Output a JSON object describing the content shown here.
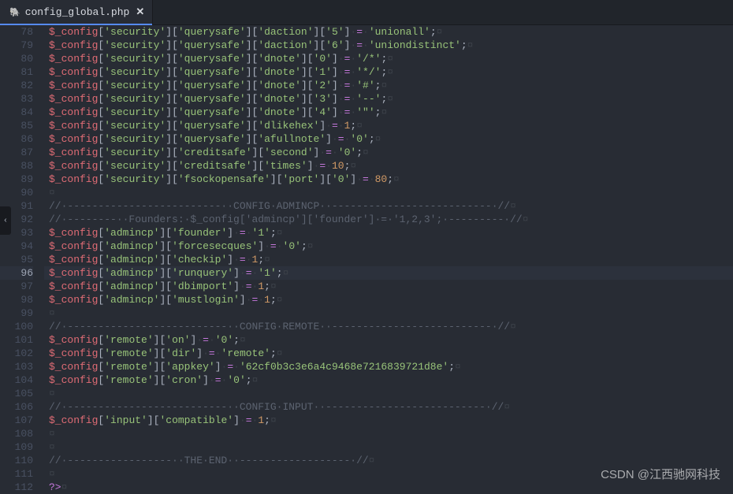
{
  "tab": {
    "filename": "config_global.php",
    "modified_glyph": "✕",
    "file_icon_glyph": "🐘"
  },
  "current_line": 96,
  "lines": [
    {
      "n": 78,
      "type": "assign",
      "var": "$_config",
      "keys": [
        "security",
        "querysafe",
        "daction",
        "5"
      ],
      "value": "unionall",
      "value_kind": "string",
      "suffix": ";"
    },
    {
      "n": 79,
      "type": "assign",
      "var": "$_config",
      "keys": [
        "security",
        "querysafe",
        "daction",
        "6"
      ],
      "value": "uniondistinct",
      "value_kind": "string",
      "suffix": ";"
    },
    {
      "n": 80,
      "type": "assign",
      "var": "$_config",
      "keys": [
        "security",
        "querysafe",
        "dnote",
        "0"
      ],
      "value": "/*",
      "value_kind": "string",
      "suffix": ";"
    },
    {
      "n": 81,
      "type": "assign",
      "var": "$_config",
      "keys": [
        "security",
        "querysafe",
        "dnote",
        "1"
      ],
      "value": "*/",
      "value_kind": "string",
      "suffix": ";"
    },
    {
      "n": 82,
      "type": "assign",
      "var": "$_config",
      "keys": [
        "security",
        "querysafe",
        "dnote",
        "2"
      ],
      "value": "#",
      "value_kind": "string",
      "suffix": ";"
    },
    {
      "n": 83,
      "type": "assign",
      "var": "$_config",
      "keys": [
        "security",
        "querysafe",
        "dnote",
        "3"
      ],
      "value": "--",
      "value_kind": "string",
      "suffix": ";"
    },
    {
      "n": 84,
      "type": "assign",
      "var": "$_config",
      "keys": [
        "security",
        "querysafe",
        "dnote",
        "4"
      ],
      "value": "\"",
      "value_kind": "string",
      "suffix": ";"
    },
    {
      "n": 85,
      "type": "assign",
      "var": "$_config",
      "keys": [
        "security",
        "querysafe",
        "dlikehex"
      ],
      "value": "1",
      "value_kind": "number",
      "suffix": ";"
    },
    {
      "n": 86,
      "type": "assign",
      "var": "$_config",
      "keys": [
        "security",
        "querysafe",
        "afullnote"
      ],
      "value": "0",
      "value_kind": "string",
      "suffix": ";"
    },
    {
      "n": 87,
      "type": "assign",
      "var": "$_config",
      "keys": [
        "security",
        "creditsafe",
        "second"
      ],
      "value": "0",
      "value_kind": "string",
      "suffix": ";"
    },
    {
      "n": 88,
      "type": "assign",
      "var": "$_config",
      "keys": [
        "security",
        "creditsafe",
        "times"
      ],
      "value": "10",
      "value_kind": "number",
      "suffix": ";"
    },
    {
      "n": 89,
      "type": "assign",
      "var": "$_config",
      "keys": [
        "security",
        "fsockopensafe",
        "port",
        "0"
      ],
      "value": "80",
      "value_kind": "number",
      "suffix": ";"
    },
    {
      "n": 90,
      "type": "blank"
    },
    {
      "n": 91,
      "type": "comment",
      "text": "// -------------------------  CONFIG ADMINCP  -------------------------- //"
    },
    {
      "n": 92,
      "type": "comment",
      "text": "// --------  Founders: $_config['admincp']['founder'] = '1,2,3'; --------- //"
    },
    {
      "n": 93,
      "type": "assign",
      "var": "$_config",
      "keys": [
        "admincp",
        "founder"
      ],
      "value": "1",
      "value_kind": "string",
      "suffix": ";"
    },
    {
      "n": 94,
      "type": "assign",
      "var": "$_config",
      "keys": [
        "admincp",
        "forcesecques"
      ],
      "value": "0",
      "value_kind": "string",
      "suffix": ";"
    },
    {
      "n": 95,
      "type": "assign",
      "var": "$_config",
      "keys": [
        "admincp",
        "checkip"
      ],
      "value": "1",
      "value_kind": "number",
      "suffix": ";"
    },
    {
      "n": 96,
      "type": "assign",
      "var": "$_config",
      "keys": [
        "admincp",
        "runquery"
      ],
      "value": "1",
      "value_kind": "string",
      "suffix": ";"
    },
    {
      "n": 97,
      "type": "assign",
      "var": "$_config",
      "keys": [
        "admincp",
        "dbimport"
      ],
      "value": "1",
      "value_kind": "number",
      "suffix": ";"
    },
    {
      "n": 98,
      "type": "assign",
      "var": "$_config",
      "keys": [
        "admincp",
        "mustlogin"
      ],
      "value": "1",
      "value_kind": "number",
      "suffix": ";"
    },
    {
      "n": 99,
      "type": "blank"
    },
    {
      "n": 100,
      "type": "comment",
      "text": "// --------------------------  CONFIG REMOTE  -------------------------- //"
    },
    {
      "n": 101,
      "type": "assign",
      "var": "$_config",
      "keys": [
        "remote",
        "on"
      ],
      "value": "0",
      "value_kind": "string",
      "suffix": ";"
    },
    {
      "n": 102,
      "type": "assign",
      "var": "$_config",
      "keys": [
        "remote",
        "dir"
      ],
      "value": "remote",
      "value_kind": "string",
      "suffix": ";"
    },
    {
      "n": 103,
      "type": "assign",
      "var": "$_config",
      "keys": [
        "remote",
        "appkey"
      ],
      "value": "62cf0b3c3e6a4c9468e7216839721d8e",
      "value_kind": "string",
      "suffix": ";"
    },
    {
      "n": 104,
      "type": "assign",
      "var": "$_config",
      "keys": [
        "remote",
        "cron"
      ],
      "value": "0",
      "value_kind": "string",
      "suffix": ";"
    },
    {
      "n": 105,
      "type": "blank"
    },
    {
      "n": 106,
      "type": "comment",
      "text": "// --------------------------  CONFIG INPUT  -------------------------- //"
    },
    {
      "n": 107,
      "type": "assign",
      "var": "$_config",
      "keys": [
        "input",
        "compatible"
      ],
      "value": "1",
      "value_kind": "number",
      "suffix": ";"
    },
    {
      "n": 108,
      "type": "blank"
    },
    {
      "n": 109,
      "type": "blank"
    },
    {
      "n": 110,
      "type": "comment",
      "text": "// -----------------  THE END  ------------------ //"
    },
    {
      "n": 111,
      "type": "blank"
    },
    {
      "n": 112,
      "type": "raw",
      "html": "<span class=\"tk-op\">?&gt;</span>"
    }
  ],
  "whitespace_glyph": "¤",
  "whitespace_middot": "·",
  "watermark": "CSDN @江西驰网科技"
}
